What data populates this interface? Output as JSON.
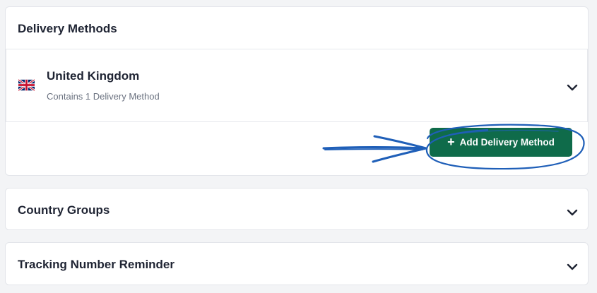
{
  "delivery_methods": {
    "title": "Delivery Methods",
    "country": {
      "name": "United Kingdom",
      "subtitle": "Contains 1 Delivery Method",
      "flag_icon": "uk-flag-icon"
    },
    "add_button": {
      "label": "Add Delivery Method",
      "plus": "+",
      "color": "#0f6b4a"
    }
  },
  "country_groups": {
    "title": "Country Groups"
  },
  "tracking_reminder": {
    "title": "Tracking Number Reminder"
  },
  "annotation": {
    "color": "#1f5fb8",
    "kind": "hand-drawn arrow and circle"
  },
  "colors": {
    "background": "#f3f4f6",
    "card": "#ffffff",
    "text": "#1f2433",
    "muted": "#6b7280"
  }
}
